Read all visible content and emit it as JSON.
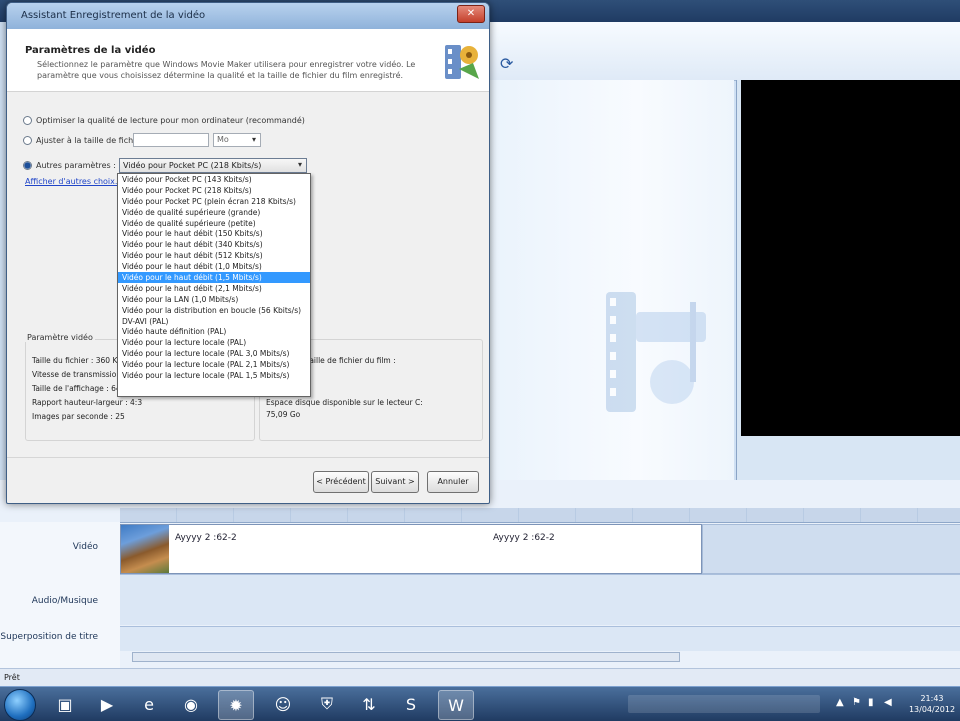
{
  "app": {
    "track_labels": [
      "Vidéo",
      "Audio/Musique",
      "Superposition de titre"
    ],
    "clips": [
      {
        "name": "Ayyyy 2 :62-2",
        "thumb": true
      },
      {
        "name": "Ayyyy 2 :62-2",
        "thumb": false
      }
    ],
    "status_text": "Prêt"
  },
  "dialog": {
    "title": "Assistant Enregistrement de la vidéo",
    "header_title": "Paramètres de la vidéo",
    "header_desc": "Sélectionnez le paramètre que Windows Movie Maker utilisera pour enregistrer votre vidéo. Le paramètre que vous choisissez détermine la qualité et la taille de fichier du film enregistré.",
    "option1": "Optimiser la qualité de lecture pour mon ordinateur (recommandé)",
    "option2": "Ajuster à la taille de fichier :",
    "option2_unit": "Mo",
    "option3": "Autres paramètres :",
    "selected_setting": "Vidéo pour Pocket PC (218 Kbits/s)",
    "more_link": "Afficher d'autres choix...",
    "settings_list": [
      "Vidéo pour Pocket PC (143 Kbits/s)",
      "Vidéo pour Pocket PC (218 Kbits/s)",
      "Vidéo pour Pocket PC (plein écran 218 Kbits/s)",
      "Vidéo de qualité supérieure (grande)",
      "Vidéo de qualité supérieure (petite)",
      "Vidéo pour le haut débit (150 Kbits/s)",
      "Vidéo pour le haut débit (340 Kbits/s)",
      "Vidéo pour le haut débit (512 Kbits/s)",
      "Vidéo pour le haut débit (1,0 Mbits/s)",
      "Vidéo pour le haut débit (1,5 Mbits/s)",
      "Vidéo pour le haut débit (2,1 Mbits/s)",
      "Vidéo pour la LAN (1,0 Mbits/s)",
      "Vidéo pour la distribution en boucle (56 Kbits/s)",
      "DV-AVI (PAL)",
      "Vidéo haute définition (PAL)",
      "Vidéo pour la lecture locale (PAL)",
      "Vidéo pour la lecture locale (PAL 3,0 Mbits/s)",
      "Vidéo pour la lecture locale (PAL 2,1 Mbits/s)",
      "Vidéo pour la lecture locale (PAL 1,5 Mbits/s)"
    ],
    "selected_index": 9,
    "settings_group_label": "Paramètre vidéo",
    "props_left": [
      "Taille du fichier : 360 Ko",
      "Vitesse de transmission : 1,5 Mbits/s",
      "Taille de l'affichage : 640 x 480 pixels",
      "Rapport hauteur-largeur : 4:3",
      "Images par seconde : 25"
    ],
    "props_right_title": "Taille de fichier du film :",
    "props_right_free": "Espace disque disponible sur le lecteur C:",
    "props_right_free_value": "75,09 Go",
    "btn_back": "< Précédent",
    "btn_next": "Suivant >",
    "btn_cancel": "Annuler"
  },
  "taskbar": {
    "time": "21:43",
    "date": "13/04/2012"
  }
}
